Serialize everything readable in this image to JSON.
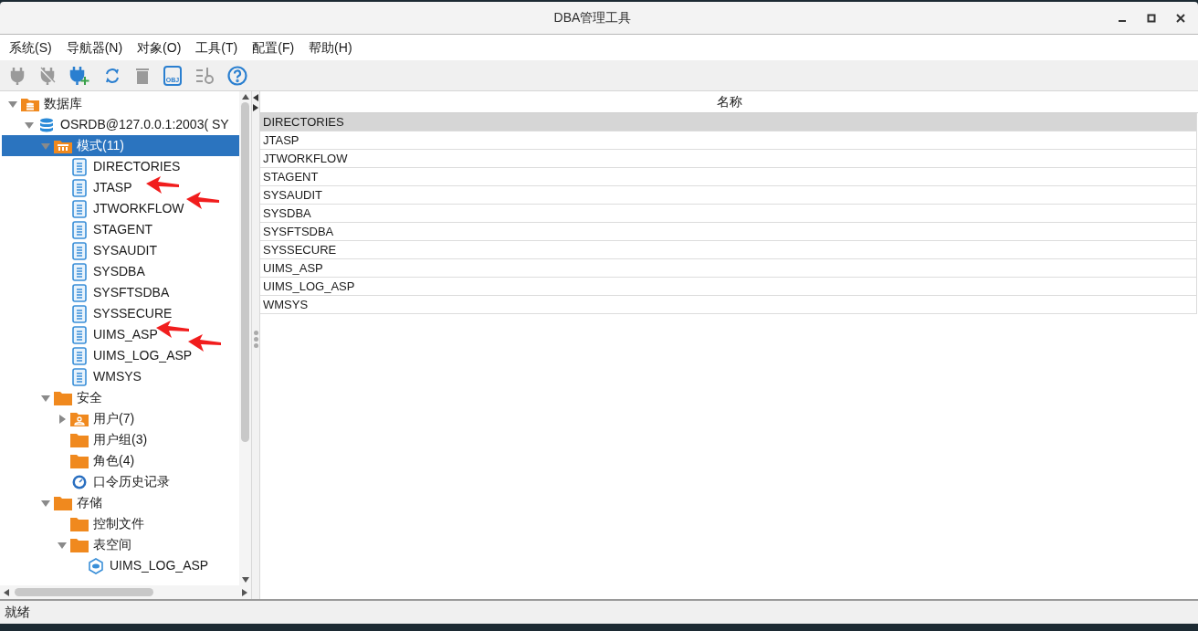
{
  "window": {
    "title": "DBA管理工具"
  },
  "menu": [
    "系统(S)",
    "导航器(N)",
    "对象(O)",
    "工具(T)",
    "配置(F)",
    "帮助(H)"
  ],
  "toolbar": [
    {
      "kind": "plug",
      "disabled": true
    },
    {
      "kind": "unplug",
      "disabled": true
    },
    {
      "kind": "plug-add",
      "disabled": false
    },
    {
      "kind": "refresh",
      "disabled": false
    },
    {
      "kind": "trash",
      "disabled": true
    },
    {
      "kind": "obj",
      "label": "OBJ",
      "disabled": false
    },
    {
      "kind": "sort",
      "disabled": true
    },
    {
      "kind": "help",
      "disabled": false
    }
  ],
  "tree": [
    {
      "label": "数据库",
      "kind": "db-folder",
      "expanded": true,
      "selected": false,
      "children": [
        {
          "label": "OSRDB@127.0.0.1:2003( SY",
          "kind": "database",
          "expanded": true,
          "selected": false,
          "children": [
            {
              "label": "模式(11)",
              "kind": "schema-folder",
              "expanded": true,
              "selected": true,
              "children": [
                {
                  "label": "DIRECTORIES",
                  "kind": "schema",
                  "selected": false
                },
                {
                  "label": "JTASP",
                  "kind": "schema",
                  "selected": false
                },
                {
                  "label": "JTWORKFLOW",
                  "kind": "schema",
                  "selected": false
                },
                {
                  "label": "STAGENT",
                  "kind": "schema",
                  "selected": false
                },
                {
                  "label": "SYSAUDIT",
                  "kind": "schema",
                  "selected": false
                },
                {
                  "label": "SYSDBA",
                  "kind": "schema",
                  "selected": false
                },
                {
                  "label": "SYSFTSDBA",
                  "kind": "schema",
                  "selected": false
                },
                {
                  "label": "SYSSECURE",
                  "kind": "schema",
                  "selected": false
                },
                {
                  "label": "UIMS_ASP",
                  "kind": "schema",
                  "selected": false
                },
                {
                  "label": "UIMS_LOG_ASP",
                  "kind": "schema",
                  "selected": false
                },
                {
                  "label": "WMSYS",
                  "kind": "schema",
                  "selected": false
                }
              ]
            },
            {
              "label": "安全",
              "kind": "folder",
              "expanded": true,
              "selected": false,
              "children": [
                {
                  "label": "用户(7)",
                  "kind": "user-folder",
                  "expanded": false,
                  "selected": false
                },
                {
                  "label": "用户组(3)",
                  "kind": "folder",
                  "selected": false
                },
                {
                  "label": "角色(4)",
                  "kind": "folder",
                  "selected": false
                },
                {
                  "label": "口令历史记录",
                  "kind": "history",
                  "selected": false
                }
              ]
            },
            {
              "label": "存储",
              "kind": "folder",
              "expanded": true,
              "selected": false,
              "children": [
                {
                  "label": "控制文件",
                  "kind": "folder",
                  "selected": false
                },
                {
                  "label": "表空间",
                  "kind": "folder",
                  "expanded": true,
                  "selected": false,
                  "children": [
                    {
                      "label": "UIMS_LOG_ASP",
                      "kind": "tablespace",
                      "selected": false
                    }
                  ]
                }
              ]
            }
          ]
        }
      ]
    }
  ],
  "table": {
    "columns": [
      "名称"
    ],
    "rows": [
      {
        "name": "DIRECTORIES",
        "selected": true
      },
      {
        "name": "JTASP",
        "selected": false
      },
      {
        "name": "JTWORKFLOW",
        "selected": false
      },
      {
        "name": "STAGENT",
        "selected": false
      },
      {
        "name": "SYSAUDIT",
        "selected": false
      },
      {
        "name": "SYSDBA",
        "selected": false
      },
      {
        "name": "SYSFTSDBA",
        "selected": false
      },
      {
        "name": "SYSSECURE",
        "selected": false
      },
      {
        "name": "UIMS_ASP",
        "selected": false
      },
      {
        "name": "UIMS_LOG_ASP",
        "selected": false
      },
      {
        "name": "WMSYS",
        "selected": false
      }
    ]
  },
  "status_bar": "就绪"
}
